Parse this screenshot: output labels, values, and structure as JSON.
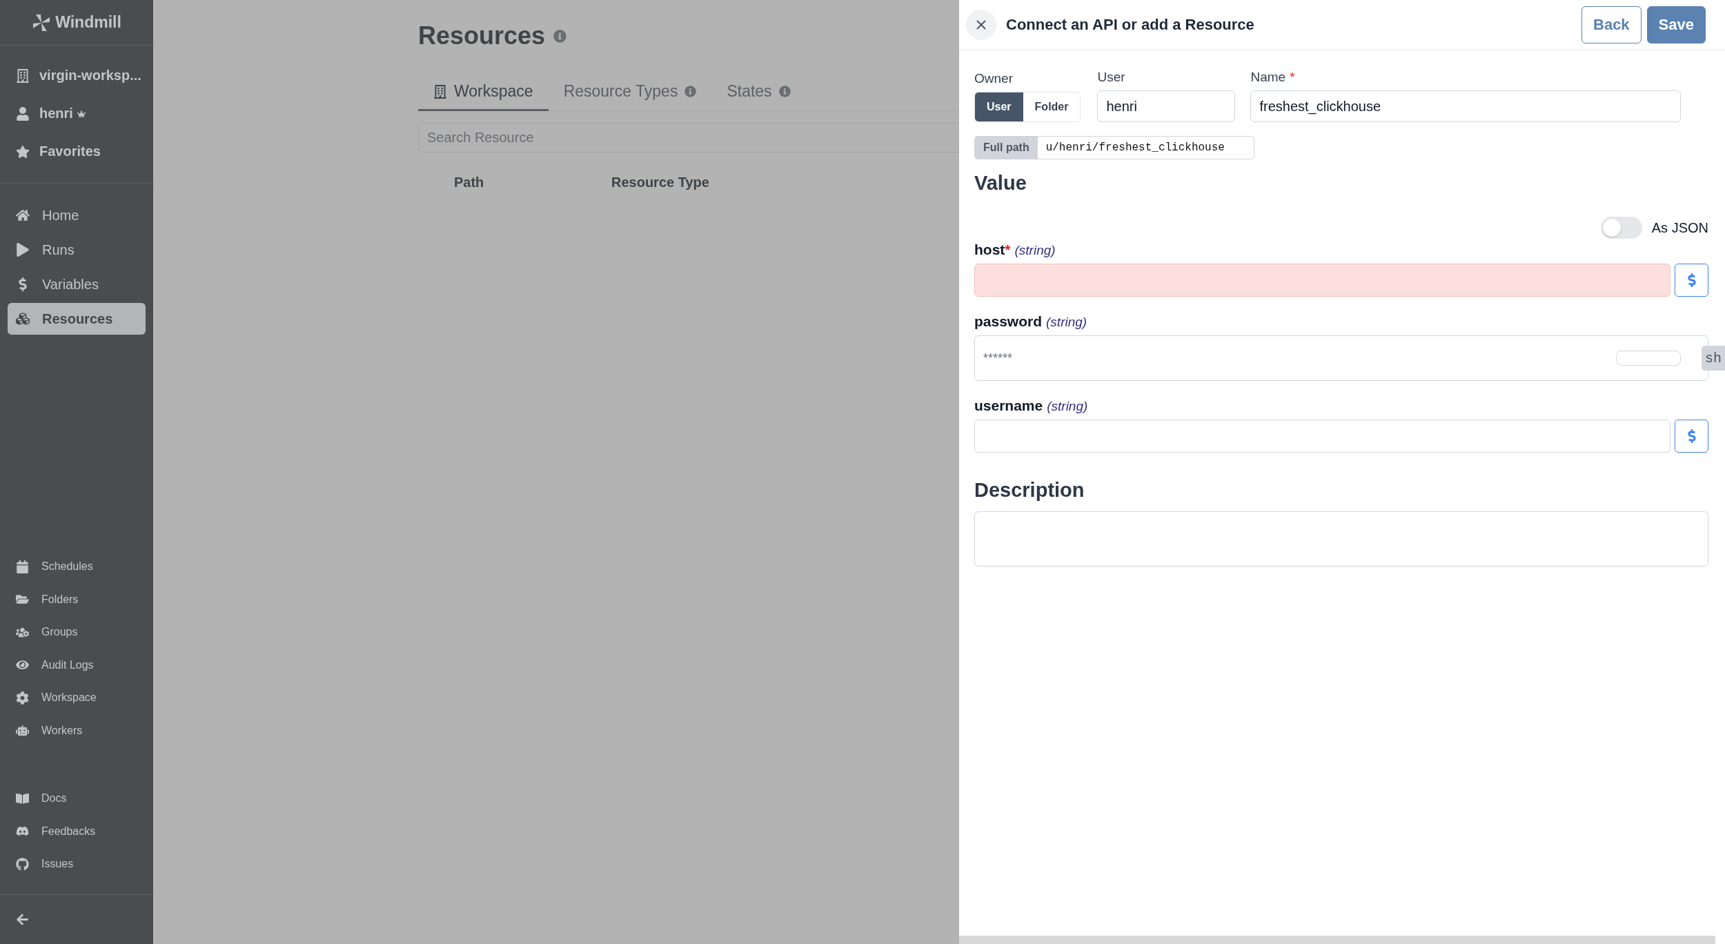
{
  "sidebar": {
    "logo": "Windmill",
    "workspace": "virgin-worksp...",
    "user": "henri",
    "favorites": "Favorites",
    "main_nav": [
      {
        "label": "Home",
        "selected": false
      },
      {
        "label": "Runs",
        "selected": false
      },
      {
        "label": "Variables",
        "selected": false
      },
      {
        "label": "Resources",
        "selected": true
      }
    ],
    "admin_nav": [
      {
        "label": "Schedules"
      },
      {
        "label": "Folders"
      },
      {
        "label": "Groups"
      },
      {
        "label": "Audit Logs"
      },
      {
        "label": "Workspace"
      },
      {
        "label": "Workers"
      }
    ],
    "help_nav": [
      {
        "label": "Docs"
      },
      {
        "label": "Feedbacks"
      },
      {
        "label": "Issues"
      }
    ]
  },
  "page": {
    "title": "Resources",
    "tabs": [
      {
        "label": "Workspace",
        "selected": true,
        "info": false
      },
      {
        "label": "Resource Types",
        "selected": false,
        "info": true
      },
      {
        "label": "States",
        "selected": false,
        "info": true
      }
    ],
    "search": {
      "placeholder": "Search Resource"
    },
    "columns": [
      "Path",
      "Resource Type"
    ]
  },
  "drawer": {
    "title": "Connect an API or add a Resource",
    "buttons": [
      {
        "label": "Back",
        "kind": "outline"
      },
      {
        "label": "Save",
        "kind": "primary"
      }
    ],
    "owner": {
      "label": "Owner",
      "options": [
        {
          "label": "User",
          "selected": true
        },
        {
          "label": "Folder",
          "selected": false
        }
      ]
    },
    "user": {
      "label": "User",
      "value": "henri"
    },
    "name": {
      "label": "Name",
      "required_mark": "*",
      "value": "freshest_clickhouse"
    },
    "full_path": {
      "label": "Full path",
      "value": "u/henri/freshest_clickhouse"
    },
    "value_heading": "Value",
    "as_json": {
      "label": "As JSON",
      "on": false
    },
    "fields": [
      {
        "name": "host",
        "required_mark": "*",
        "type": "(string)",
        "invalid": true,
        "kind": "text"
      },
      {
        "name": "password",
        "type": "(string)",
        "kind": "password",
        "placeholder": "******",
        "reveal": "sh"
      },
      {
        "name": "username",
        "type": "(string)",
        "invalid": false,
        "kind": "text"
      }
    ],
    "description_heading": "Description"
  }
}
